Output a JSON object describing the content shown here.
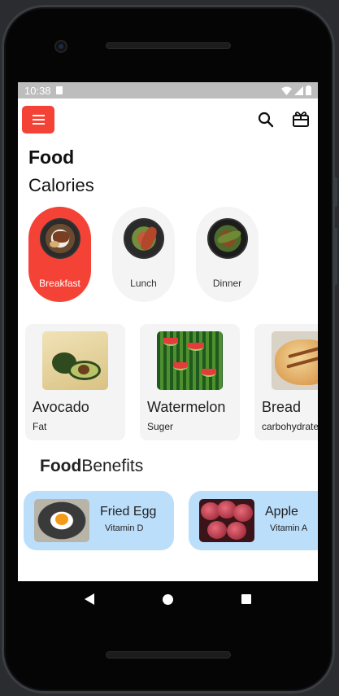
{
  "status": {
    "time": "10:38"
  },
  "header": {
    "title": "Food",
    "subtitle": "Calories"
  },
  "icons": {
    "menu": "menu-icon",
    "search": "search-icon",
    "gift": "gift-icon"
  },
  "categories": [
    {
      "label": "Breakfast",
      "active": true
    },
    {
      "label": "Lunch",
      "active": false
    },
    {
      "label": "Dinner",
      "active": false
    }
  ],
  "foods": [
    {
      "name": "Avocado",
      "sub": "Fat"
    },
    {
      "name": "Watermelon",
      "sub": "Suger"
    },
    {
      "name": "Bread",
      "sub": "carbohydrate"
    }
  ],
  "benefits_title": {
    "bold": "Food",
    "rest": "Benefits"
  },
  "benefits": [
    {
      "name": "Fried Egg",
      "sub": "Vitamin D"
    },
    {
      "name": "Apple",
      "sub": "Vitamin A"
    }
  ],
  "colors": {
    "accent": "#f44336",
    "benefit_card": "#bbdefb",
    "card": "#f4f4f4"
  }
}
